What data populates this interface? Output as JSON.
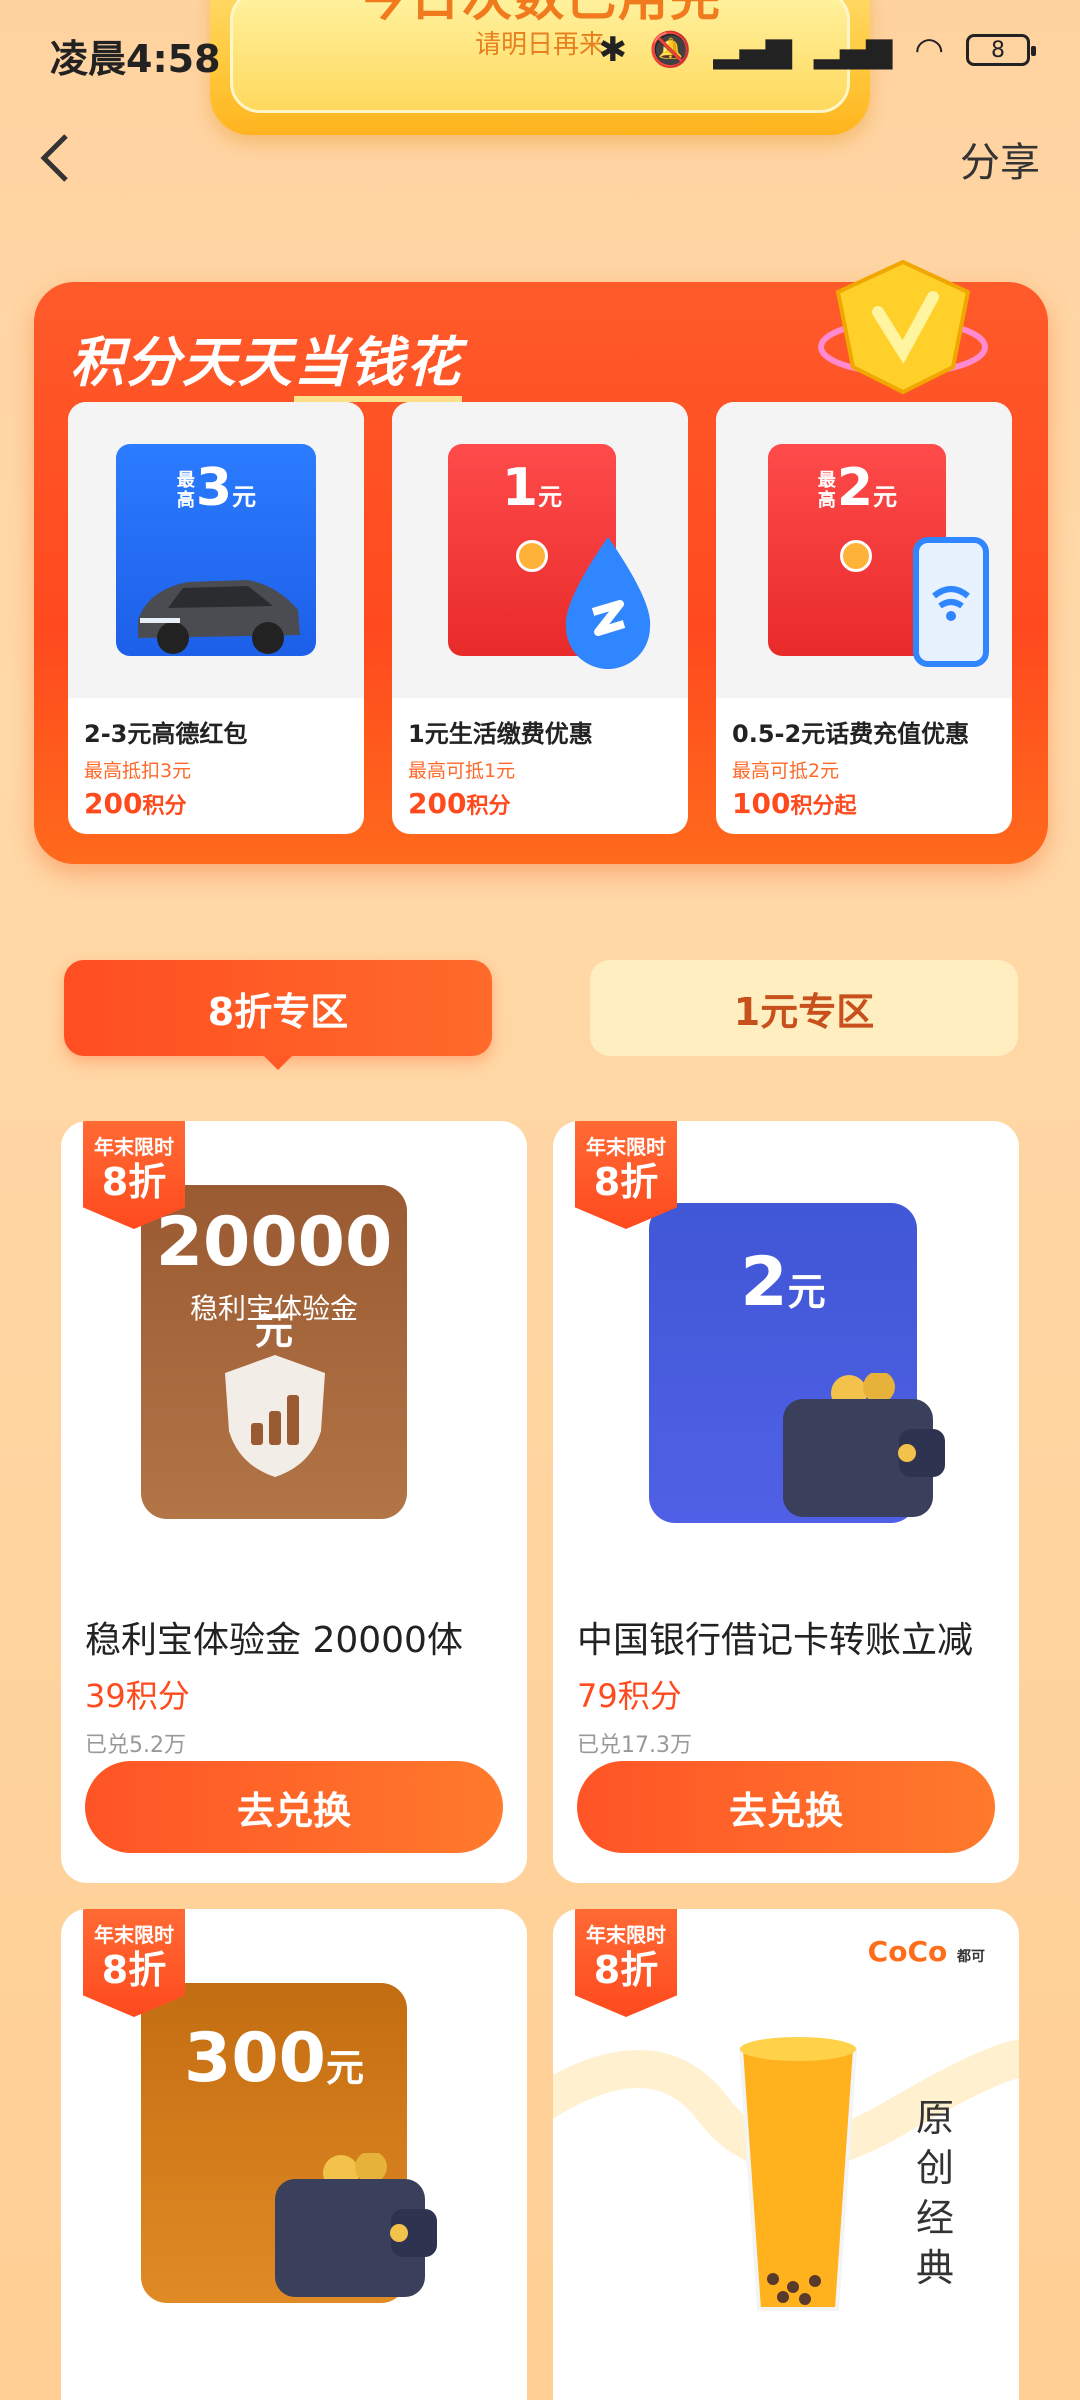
{
  "status_bar": {
    "time": "凌晨4:58",
    "battery": "8"
  },
  "banner": {
    "title": "今日次数已用完",
    "subtitle": "请明日再来"
  },
  "nav": {
    "back_label": "‹",
    "share": "分享"
  },
  "promo": {
    "title_part1": "积分天天",
    "title_part2": "当钱花",
    "cards": [
      {
        "ticket_prefix": "最高",
        "ticket_amount": "3",
        "ticket_unit": "元",
        "name": "2-3元高德红包",
        "limit": "最高抵扣3元",
        "points": "200",
        "points_unit": "积分"
      },
      {
        "ticket_prefix": "",
        "ticket_amount": "1",
        "ticket_unit": "元",
        "name": "1元生活缴费优惠",
        "limit": "最高可抵1元",
        "points": "200",
        "points_unit": "积分"
      },
      {
        "ticket_prefix": "最高",
        "ticket_amount": "2",
        "ticket_unit": "元",
        "name": "0.5-2元话费充值优惠",
        "limit": "最高可抵2元",
        "points": "100",
        "points_unit": "积分起"
      }
    ]
  },
  "tabs": {
    "active": "8折专区",
    "inactive": "1元专区"
  },
  "badge": {
    "line1": "年末限时",
    "line2": "8折"
  },
  "products": [
    {
      "img_amount": "20000",
      "img_unit": "元",
      "img_sub": "稳利宝体验金",
      "title": "稳利宝体验金 20000体",
      "price": "39积分",
      "sold": "已兑5.2万",
      "button": "去兑换"
    },
    {
      "img_amount": "2",
      "img_unit": "元",
      "title": "中国银行借记卡转账立减",
      "price": "79积分",
      "sold": "已兑17.3万",
      "button": "去兑换"
    },
    {
      "img_amount": "300",
      "img_unit": "元"
    },
    {
      "brand": "CoCo",
      "brand_sub": "都可",
      "vertical_text": "原创经典"
    }
  ],
  "colors": {
    "primary": "#ff4a1e",
    "background": "#ffd9a8",
    "tab_inactive_bg": "#ffefc0"
  }
}
